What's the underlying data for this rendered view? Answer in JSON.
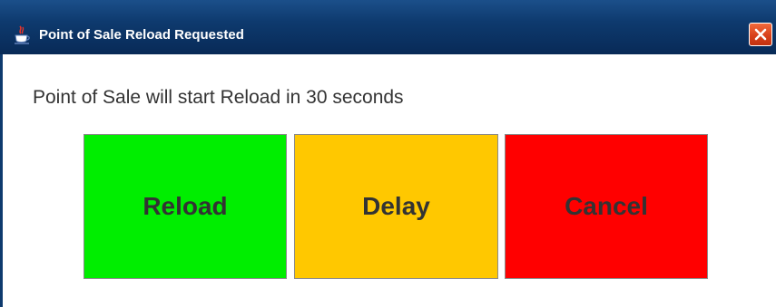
{
  "window": {
    "title": "Point of Sale Reload Requested",
    "icon": "java-cup-icon",
    "close_icon": "close-icon"
  },
  "dialog": {
    "message": "Point of Sale will start Reload in 30 seconds"
  },
  "buttons": {
    "reload": {
      "label": "Reload",
      "color": "#00ee00"
    },
    "delay": {
      "label": "Delay",
      "color": "#ffc800"
    },
    "cancel": {
      "label": "Cancel",
      "color": "#ff0000"
    }
  },
  "colors": {
    "titlebar": "#0e3a6e",
    "close_button": "#d8411b",
    "text": "#333333"
  }
}
